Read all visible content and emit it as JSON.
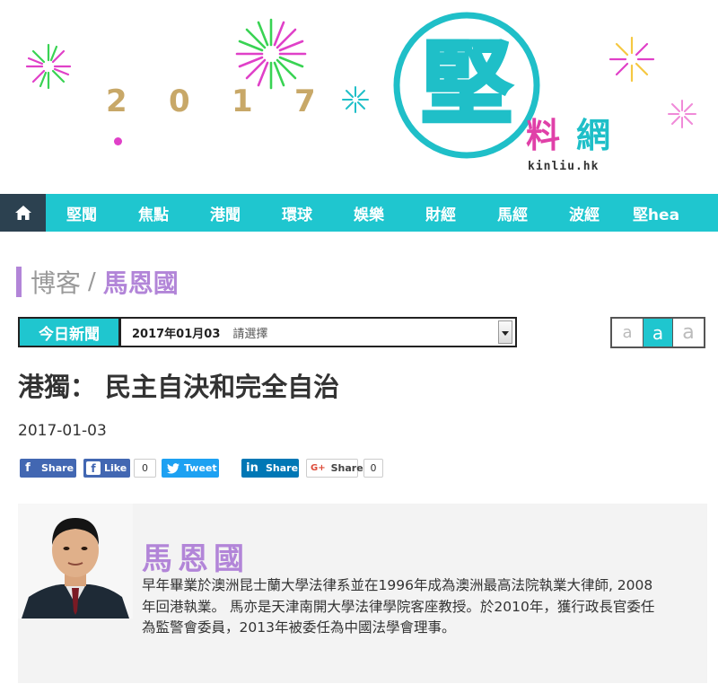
{
  "banner": {
    "year_digits": [
      "2",
      "0",
      "1",
      "7"
    ],
    "logo_main": "堅",
    "logo_sub1": "料",
    "logo_sub2": "網",
    "logo_url": "kinliu.hk"
  },
  "nav": {
    "home_icon": "home-icon",
    "items": [
      "堅聞",
      "焦點",
      "港聞",
      "環球",
      "娛樂",
      "財經",
      "馬經",
      "波經",
      "堅hea"
    ]
  },
  "breadcrumb": {
    "section": "博客",
    "separator": "/",
    "author": "馬恩國"
  },
  "date_picker": {
    "label": "今日新聞",
    "date": "2017年01月03",
    "select_placeholder": "請選擇"
  },
  "font_sizes": [
    "a",
    "a",
    "a"
  ],
  "article": {
    "title": "港獨： 民主自決和完全自治",
    "date": "2017-01-03"
  },
  "share": {
    "fb_share_label": "Share",
    "fb_like_label": "Like",
    "fb_like_count": "0",
    "tweet_label": "Tweet",
    "linkedin_label": "Share",
    "gplus_label": "Share",
    "gplus_count": "0"
  },
  "author": {
    "name": "馬恩國",
    "bio": "早年畢業於澳洲昆士蘭大學法律系並在1996年成為澳洲最高法院執業大律師, 2008年回港執業。 馬亦是天津南開大學法律學院客座教授。於2010年，獲行政長官委任為監警會委員，2013年被委任為中國法學會理事。"
  },
  "colors": {
    "accent": "#1fc6cf",
    "purple": "#b285d8",
    "nav_home": "#2c4150",
    "gold": "#c8a868",
    "pink": "#e040a8"
  }
}
